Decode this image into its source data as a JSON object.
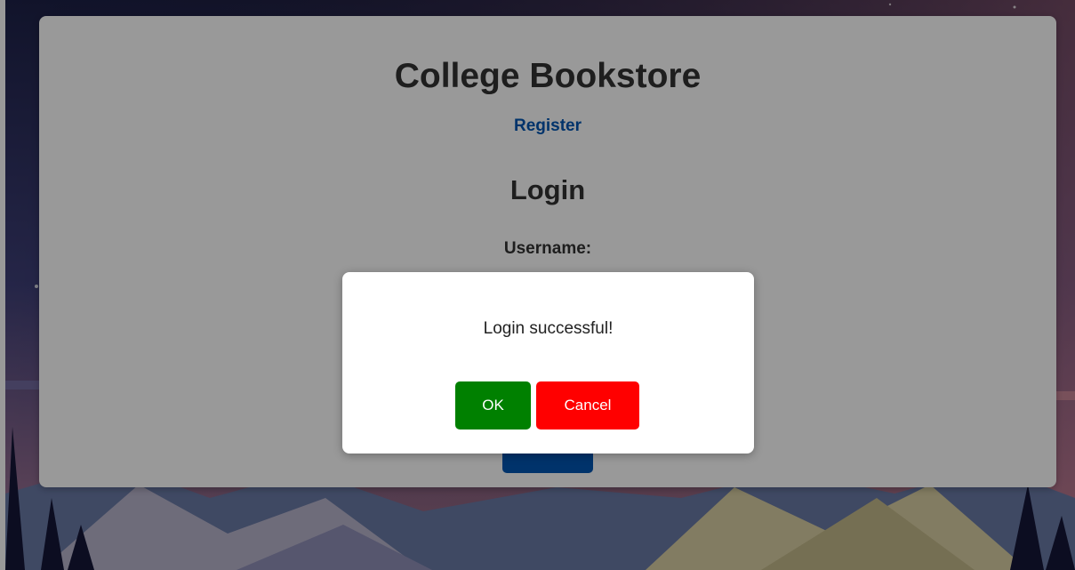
{
  "page": {
    "title": "College Bookstore",
    "register_link": "Register",
    "login_heading": "Login",
    "username_label": "Username:",
    "login_button_label": ""
  },
  "modal": {
    "message": "Login successful!",
    "ok_label": "OK",
    "cancel_label": "Cancel"
  },
  "colors": {
    "link": "#0056b3",
    "heading": "#333333",
    "ok_button": "#008000",
    "cancel_button": "#ff0000",
    "overlay": "rgba(0,0,0,0.4)"
  },
  "background": {
    "scene": "mountain-landscape-illustration"
  }
}
